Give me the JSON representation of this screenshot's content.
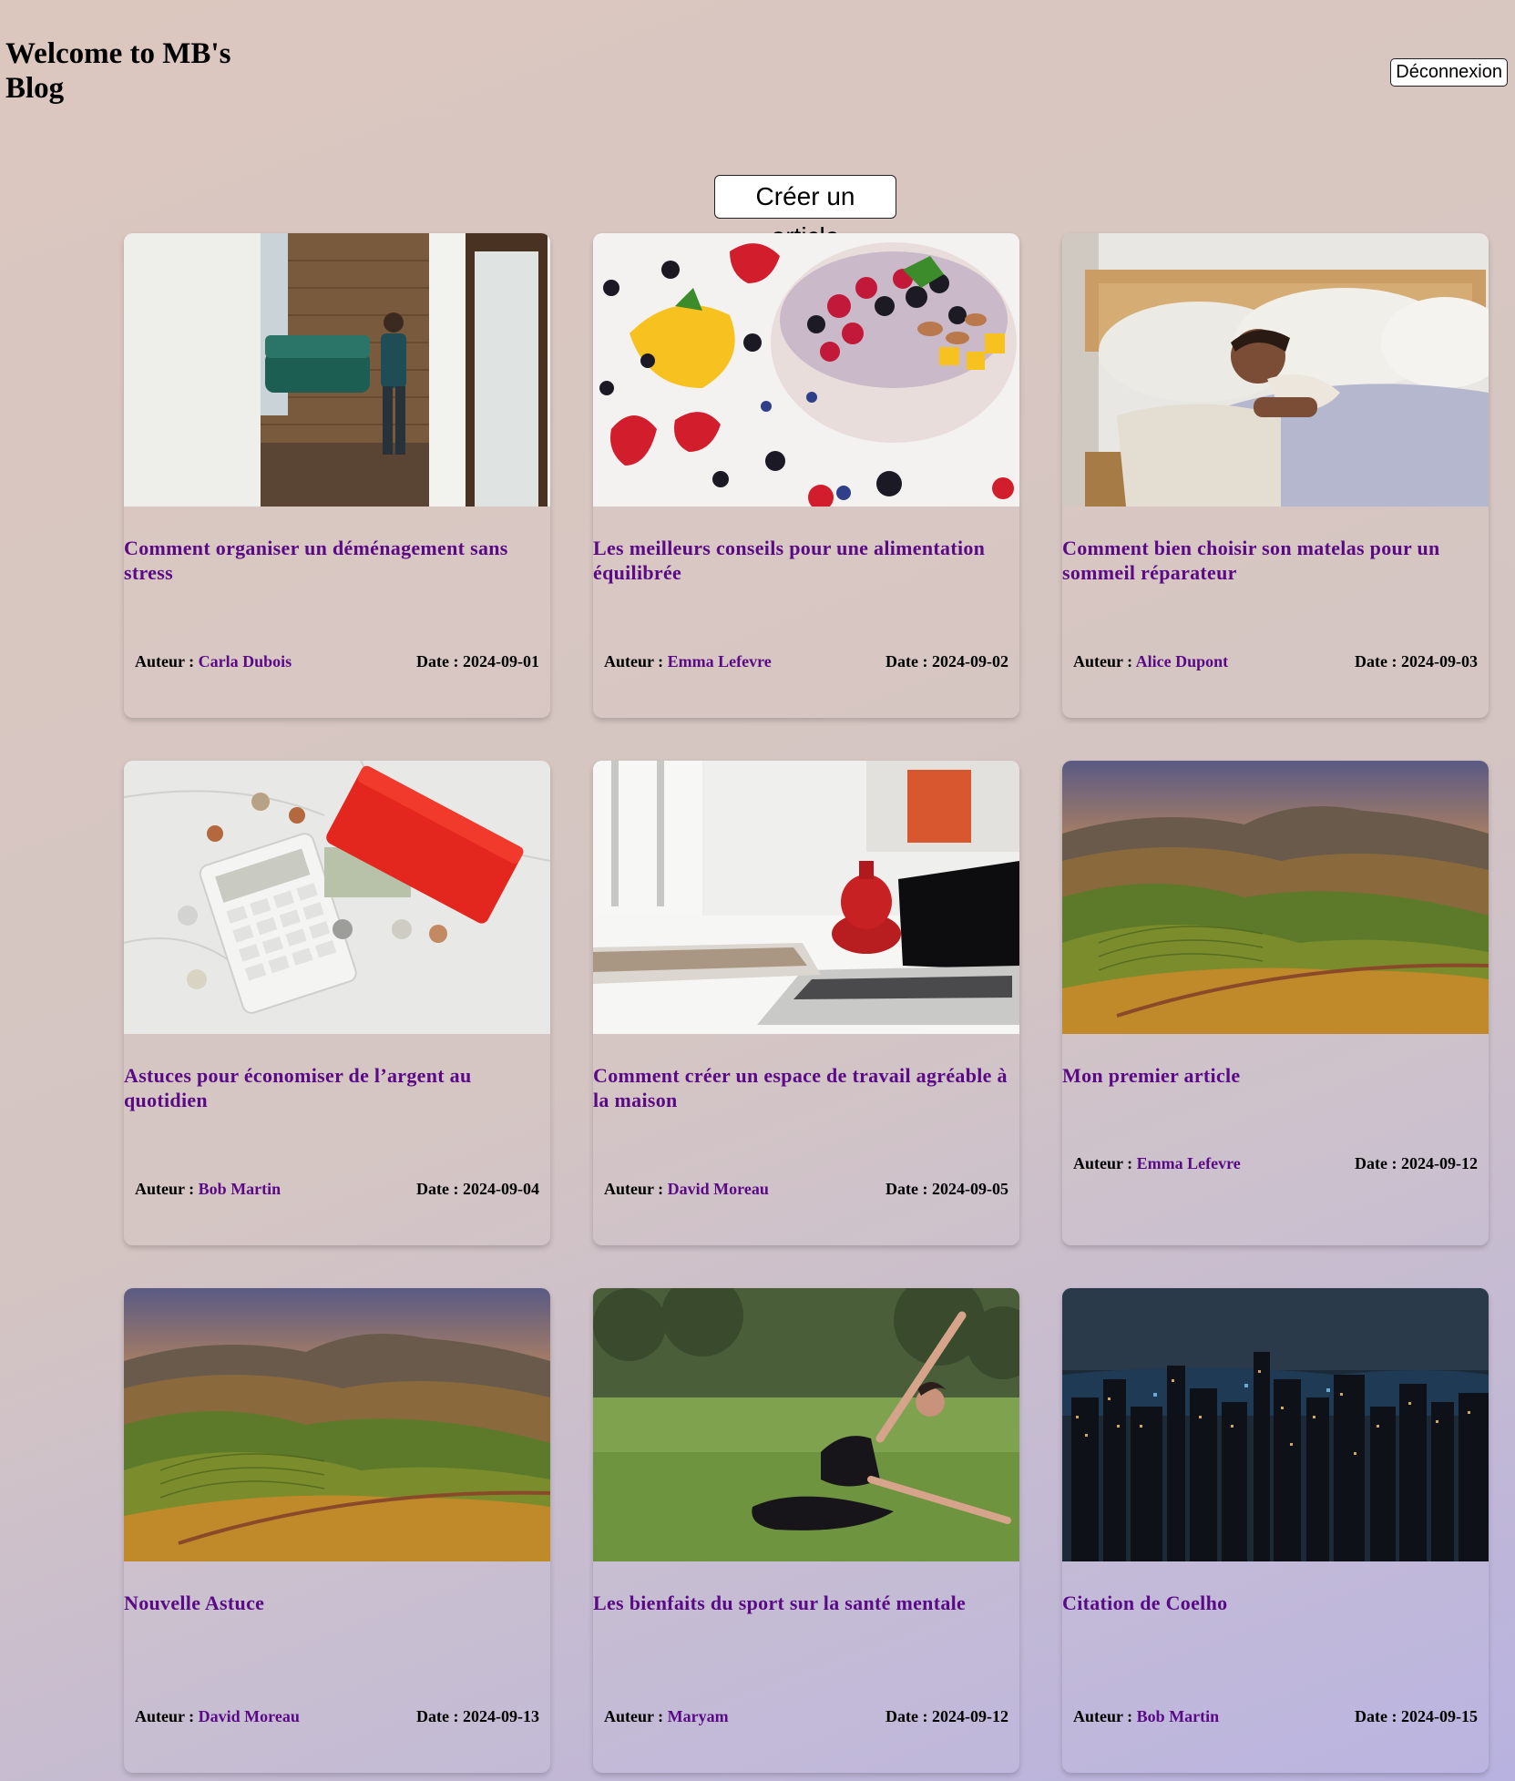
{
  "header": {
    "title": "Welcome to MB's Blog",
    "logout_label": "Déconnexion"
  },
  "create_label": "Créer un article",
  "labels": {
    "author": "Auteur : ",
    "date": "Date : "
  },
  "articles": [
    {
      "title": "Comment organiser un déménagement sans stress",
      "author": "Carla Dubois",
      "date": "2024-09-01",
      "image": "moving"
    },
    {
      "title": "Les meilleurs conseils pour une alimentation équilibrée",
      "author": "Emma Lefevre",
      "date": "2024-09-02",
      "image": "fruit-bowl"
    },
    {
      "title": "Comment bien choisir son matelas pour un sommeil réparateur",
      "author": "Alice Dupont",
      "date": "2024-09-03",
      "image": "sleeping"
    },
    {
      "title": "Astuces pour économiser de l’argent au quotidien",
      "author": "Bob Martin",
      "date": "2024-09-04",
      "image": "calculator-wallet"
    },
    {
      "title": "Comment créer un espace de travail agréable à la maison",
      "author": "David Moreau",
      "date": "2024-09-05",
      "image": "laptop-desk"
    },
    {
      "title": "Mon premier article",
      "author": "Emma Lefevre",
      "date": "2024-09-12",
      "image": "hills-sunset"
    },
    {
      "title": "Nouvelle Astuce",
      "author": "David Moreau",
      "date": "2024-09-13",
      "image": "hills-sunset"
    },
    {
      "title": "Les bienfaits du sport sur la santé mentale",
      "author": "Maryam",
      "date": "2024-09-12",
      "image": "yoga"
    },
    {
      "title": "Citation de Coelho",
      "author": "Bob Martin",
      "date": "2024-09-15",
      "image": "city-night"
    }
  ],
  "colors": {
    "title_accent": "#5a0a86"
  }
}
